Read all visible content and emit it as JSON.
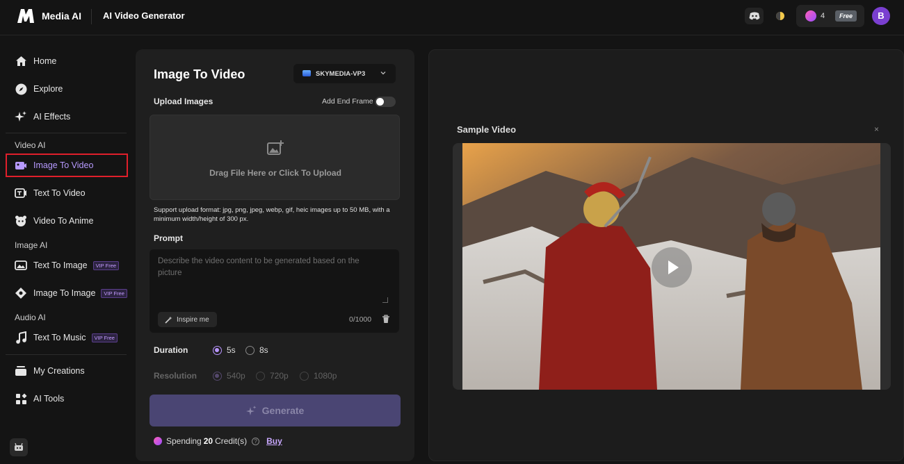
{
  "header": {
    "brand": "Media AI",
    "page_title": "AI Video Generator",
    "credits": "4",
    "plan_badge": "Free",
    "avatar_initial": "B"
  },
  "sidebar": {
    "top_items": [
      {
        "label": "Home",
        "icon": "home-icon"
      },
      {
        "label": "Explore",
        "icon": "compass-icon"
      },
      {
        "label": "AI Effects",
        "icon": "sparkle-icon"
      }
    ],
    "sections": {
      "video": "Video AI",
      "image": "Image AI",
      "audio": "Audio AI"
    },
    "video_items": [
      {
        "label": "Image To Video",
        "active": true
      },
      {
        "label": "Text To Video"
      },
      {
        "label": "Video To Anime"
      }
    ],
    "image_items": [
      {
        "label": "Text To Image",
        "badge": "VIP Free"
      },
      {
        "label": "Image To Image",
        "badge": "VIP Free"
      }
    ],
    "audio_items": [
      {
        "label": "Text To Music",
        "badge": "VIP Free"
      }
    ],
    "bottom_items": [
      {
        "label": "My Creations"
      },
      {
        "label": "AI Tools"
      }
    ]
  },
  "form": {
    "title": "Image To Video",
    "model": "SKYMEDIA-VP3",
    "upload_label": "Upload Images",
    "end_frame_label": "Add End Frame",
    "end_frame_on": false,
    "upload_cta": "Drag File Here or Click To Upload",
    "support_text": "Support upload format: jpg, png, jpeg, webp, gif, heic images up to 50 MB, with a minimum width/height of 300 px.",
    "prompt_label": "Prompt",
    "prompt_placeholder": "Describe the video content to be generated based on the picture",
    "inspire_label": "Inspire me",
    "char_count": "0/1000",
    "duration_label": "Duration",
    "durations": [
      "5s",
      "8s"
    ],
    "duration_selected": "5s",
    "resolution_label": "Resolution",
    "resolutions": [
      "540p",
      "720p",
      "1080p"
    ],
    "resolution_selected": "540p",
    "generate_label": "Generate",
    "spending_prefix": "Spending",
    "spending_amount": "20",
    "spending_suffix": "Credit(s)",
    "buy_label": "Buy"
  },
  "preview": {
    "title": "Sample Video",
    "close_glyph": "×"
  },
  "colors": {
    "accent": "#b996ff",
    "active_outline": "#e01f2b",
    "generate_bg": "#4a4573"
  }
}
